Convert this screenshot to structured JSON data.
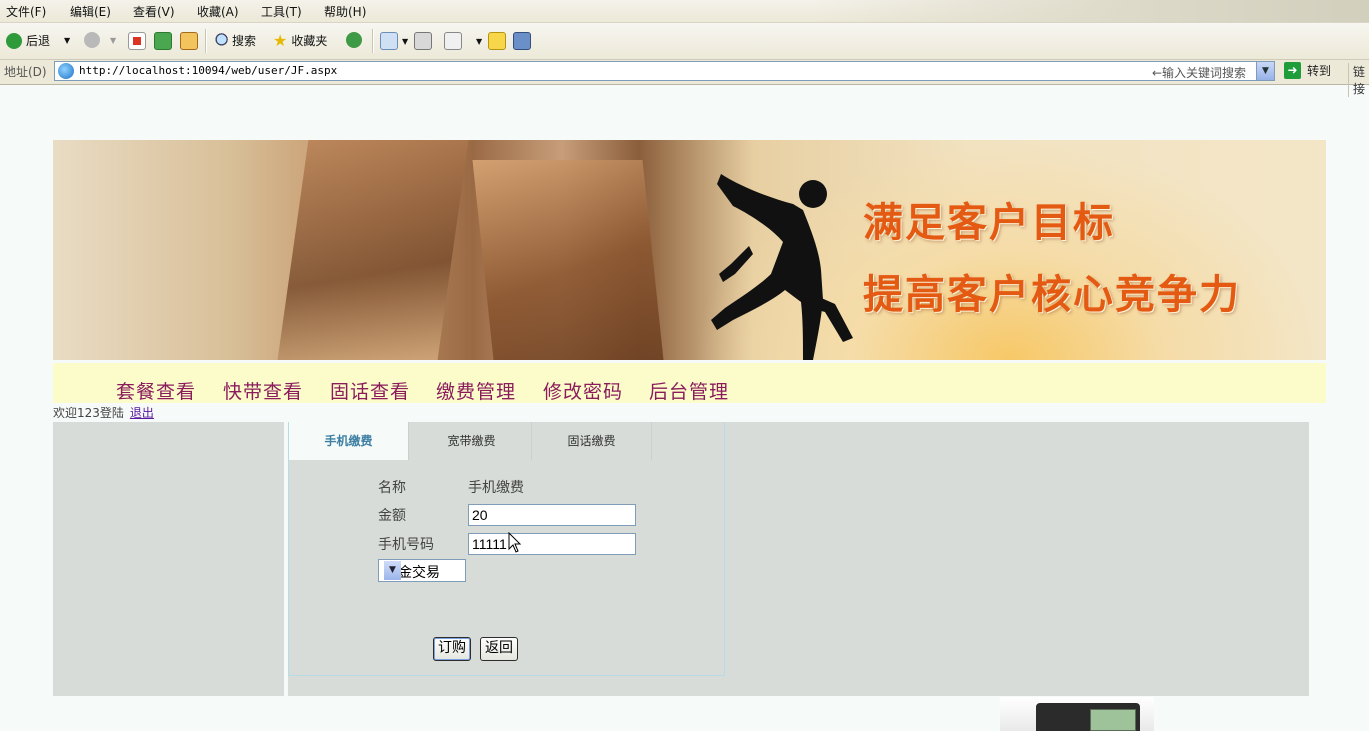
{
  "browser": {
    "menu": [
      "文件(F)",
      "编辑(E)",
      "查看(V)",
      "收藏(A)",
      "工具(T)",
      "帮助(H)"
    ],
    "toolbar": {
      "back": "后退",
      "search": "搜索",
      "favorites": "收藏夹"
    },
    "address": {
      "label": "地址(D)",
      "url": "http://localhost:10094/web/user/JF.aspx",
      "search_hint": "←输入关键词搜索",
      "go": "转到",
      "links": "链接"
    }
  },
  "banner": {
    "slogan_line1": "满足客户目标",
    "slogan_line2": "提高客户核心竞争力"
  },
  "nav": [
    "套餐查看",
    "快带查看",
    "固话查看",
    "缴费管理",
    "修改密码",
    "后台管理"
  ],
  "welcome": {
    "text": "欢迎123登陆",
    "logout": "退出"
  },
  "tabs": [
    "手机缴费",
    "宽带缴费",
    "固话缴费"
  ],
  "active_tab": "手机缴费",
  "form": {
    "name_label": "名称",
    "name_value": "手机缴费",
    "amount_label": "金额",
    "amount_value": "20",
    "phone_label": "手机号码",
    "phone_value": "11111",
    "payment_method": "现金交易",
    "submit": "订购",
    "back": "返回"
  },
  "colors": {
    "nav_text": "#8a1c5c",
    "nav_bg": "#fcfccb",
    "panel_bg": "#d7dcd9",
    "active_tab_text": "#3d7fa3",
    "slogan": "#e45a12"
  }
}
